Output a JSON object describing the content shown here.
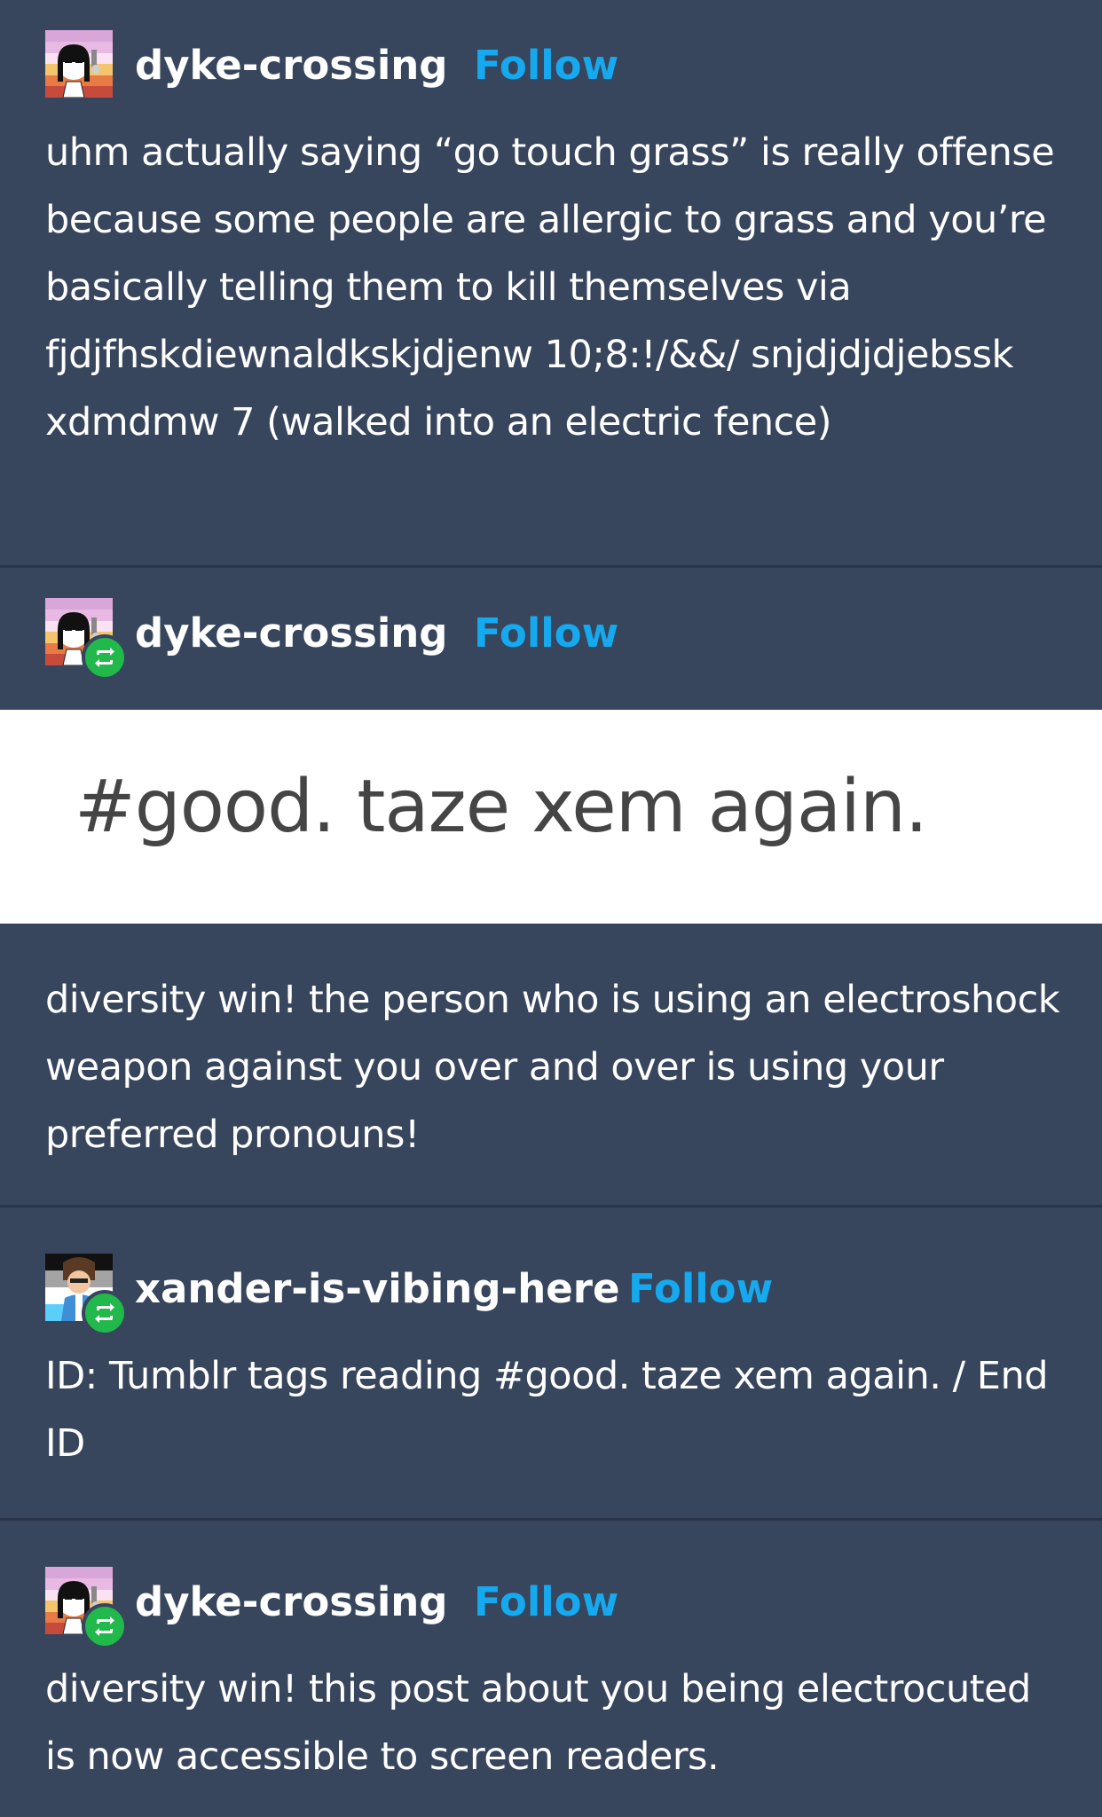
{
  "posts": [
    {
      "username": "dyke-crossing",
      "follow_label": "Follow",
      "reblog": false,
      "text": "uhm actually saying “go touch grass” is really offense because some people are allergic to grass and you’re basically telling them to kill themselves via fjdjfhskdiewnaldkskjdjenw 10;8:!/&&/ snjdjdjdjebssk xdmdmw 7 (walked into an electric fence)"
    },
    {
      "username": "dyke-crossing",
      "follow_label": "Follow",
      "reblog": true,
      "tags_image_text": "#good. taze xem again.",
      "text": "diversity win! the person who is using an electroshock weapon against you over and over is using your preferred pronouns!"
    },
    {
      "username": "xander-is-vibing-here",
      "follow_label": "Follow",
      "reblog": true,
      "text": "ID: Tumblr tags reading #good. taze xem again. / End ID"
    },
    {
      "username": "dyke-crossing",
      "follow_label": "Follow",
      "reblog": true,
      "text": "diversity win! this post about you being electrocuted is now accessible to screen readers."
    }
  ],
  "colors": {
    "background": "#37455d",
    "divider": "#2b3549",
    "follow": "#15aaf0",
    "reblog_badge": "#21b94b"
  },
  "icons": {
    "avatar_dyke": "avatar-icon",
    "avatar_xander": "avatar-icon",
    "reblog": "reblog-icon"
  }
}
